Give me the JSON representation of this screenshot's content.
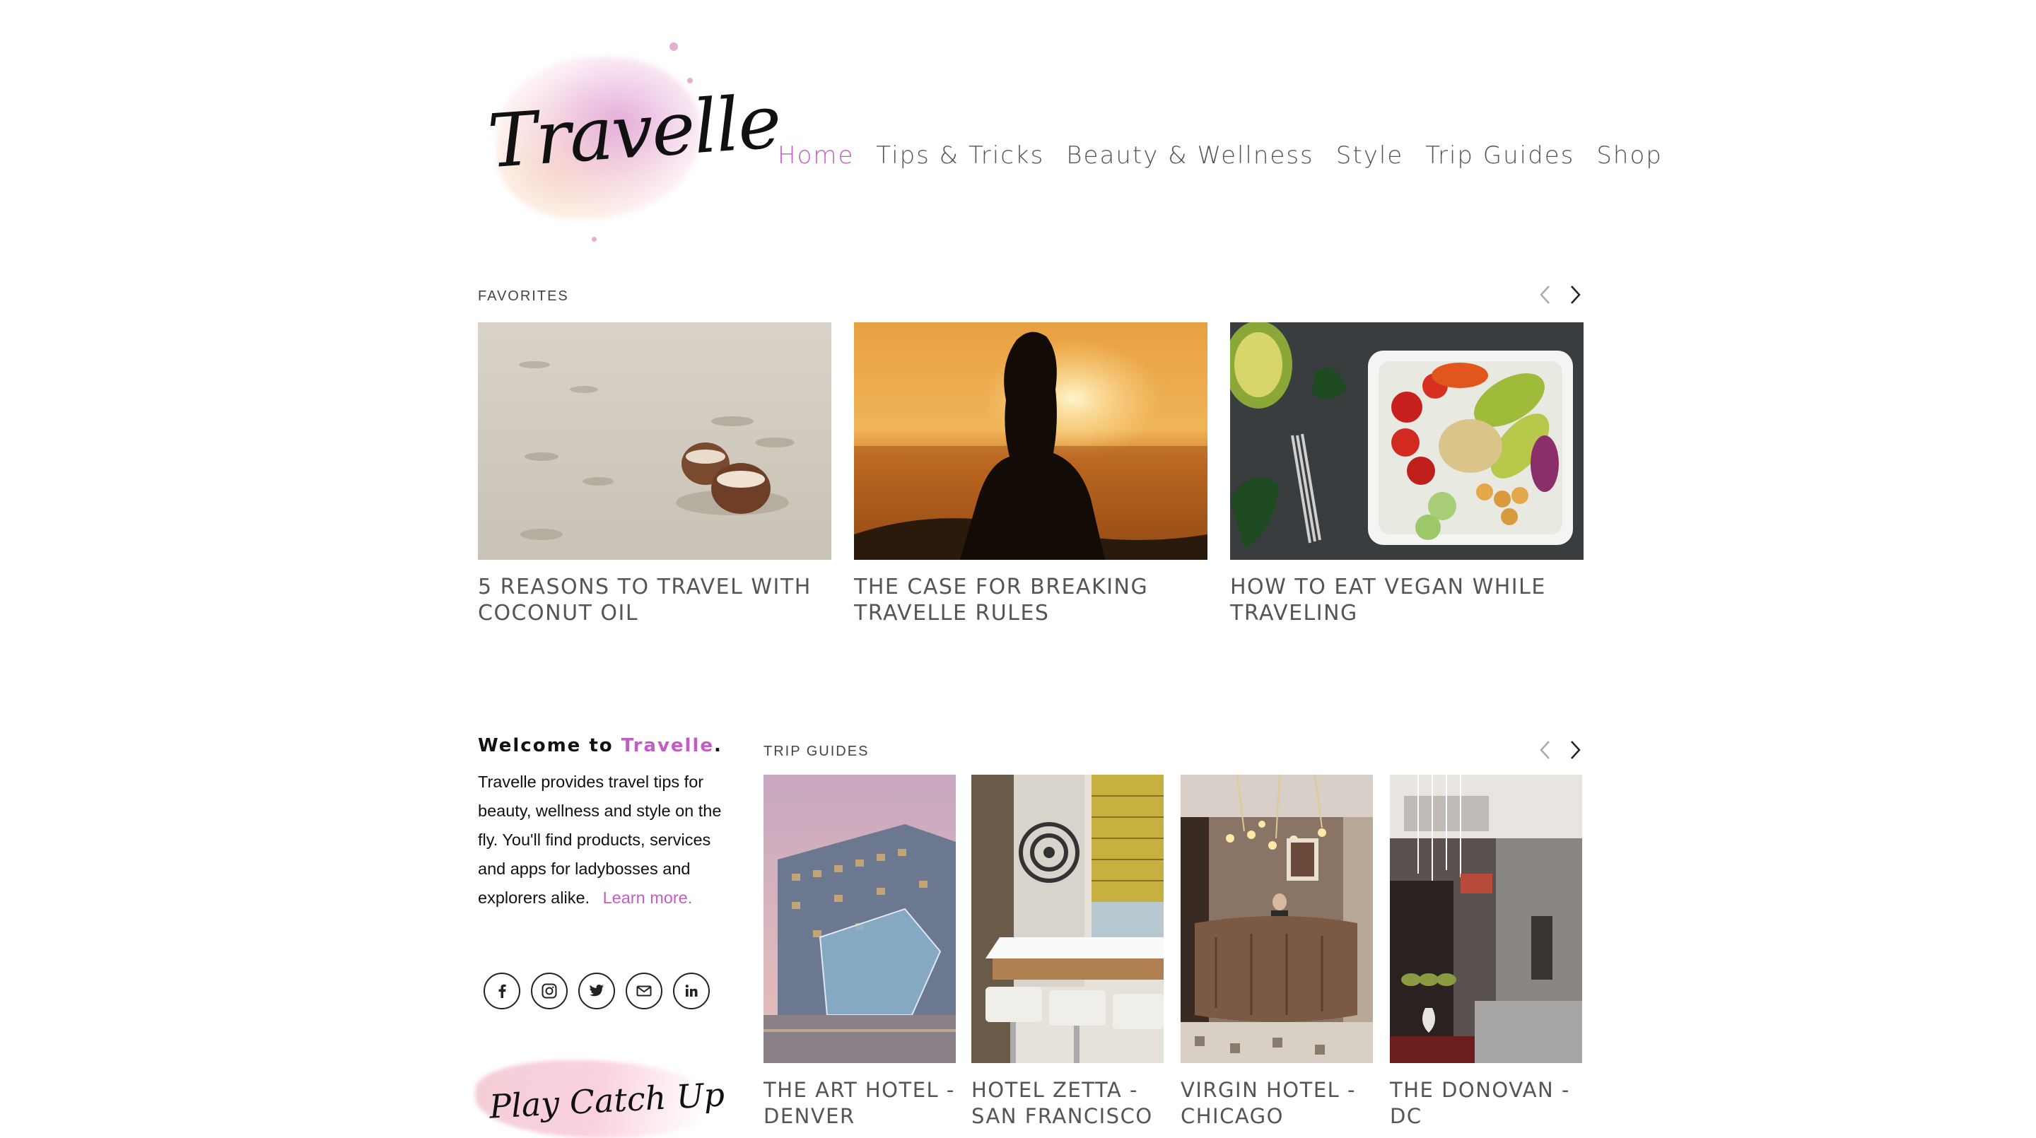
{
  "logo": {
    "text": "Travelle"
  },
  "nav": {
    "items": [
      {
        "label": "Home",
        "active": true
      },
      {
        "label": "Tips & Tricks",
        "active": false
      },
      {
        "label": "Beauty & Wellness",
        "active": false
      },
      {
        "label": "Style",
        "active": false
      },
      {
        "label": "Trip Guides",
        "active": false
      },
      {
        "label": "Shop",
        "active": false
      }
    ]
  },
  "favorites": {
    "label": "FAVORITES",
    "prev_icon": "chevron-left-icon",
    "next_icon": "chevron-right-icon",
    "cards": [
      {
        "title": "5 REASONS TO TRAVEL WITH COCONUT OIL",
        "image": "beach coconuts photo"
      },
      {
        "title": "THE CASE FOR BREAKING TRAVELLE RULES",
        "image": "sunset silhouette photo"
      },
      {
        "title": "HOW TO EAT VEGAN WHILE TRAVELING",
        "image": "vegan bowl photo"
      }
    ]
  },
  "welcome": {
    "heading_prefix": "Welcome to ",
    "heading_brand": "Travelle",
    "heading_suffix": ".",
    "body": "Travelle provides travel tips for beauty, wellness and style on the fly. You'll find products, services and apps for ladybosses and explorers alike.",
    "learn_more": "Learn more."
  },
  "socials": [
    {
      "name": "facebook-icon",
      "glyph": "f"
    },
    {
      "name": "instagram-icon",
      "glyph": "◎"
    },
    {
      "name": "twitter-icon",
      "glyph": "🐦"
    },
    {
      "name": "email-icon",
      "glyph": "✉"
    },
    {
      "name": "linkedin-icon",
      "glyph": "in"
    }
  ],
  "catchup": {
    "text": "Play Catch Up"
  },
  "trip_guides": {
    "label": "TRIP GUIDES",
    "cards": [
      {
        "title": "THE ART HOTEL - DENVER",
        "image": "art hotel exterior"
      },
      {
        "title": "HOTEL ZETTA - SAN FRANCISCO",
        "image": "hotel zetta bar"
      },
      {
        "title": "VIRGIN HOTEL - CHICAGO",
        "image": "virgin hotel lobby"
      },
      {
        "title": "THE DONOVAN - DC",
        "image": "donovan hotel lobby"
      }
    ]
  },
  "colors": {
    "accent": "#c45cc8",
    "text": "#555555"
  }
}
